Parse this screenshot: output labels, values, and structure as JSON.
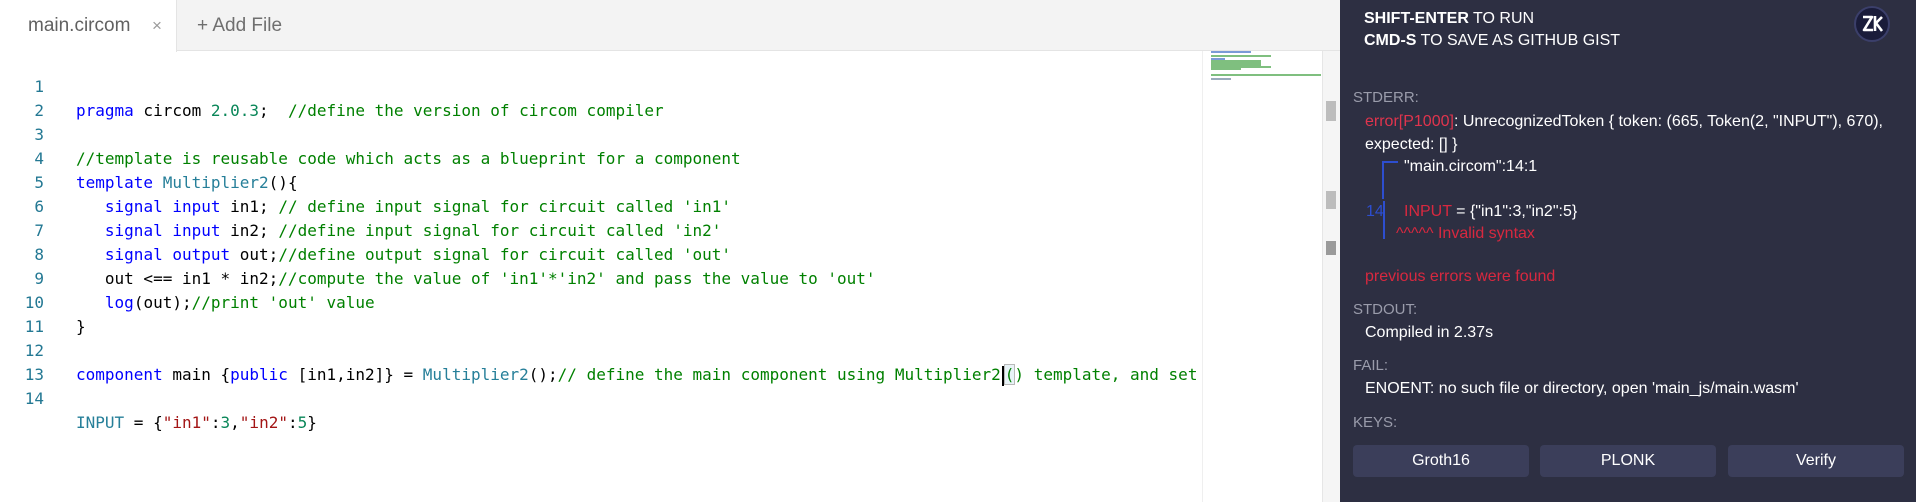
{
  "tabs": {
    "active": "main.circom",
    "close_glyph": "×",
    "add_file": "+ Add File"
  },
  "editor": {
    "line_numbers": [
      "1",
      "2",
      "3",
      "4",
      "5",
      "6",
      "7",
      "8",
      "9",
      "10",
      "11",
      "12",
      "13",
      "14"
    ],
    "lines": [
      "pragma circom 2.0.3;  //define the version of circom compiler",
      "",
      "//template is reusable code which acts as a blueprint for a component",
      "template Multiplier2(){",
      "   signal input in1; // define input signal for circuit called 'in1'",
      "   signal input in2; //define input signal for circuit called 'in2'",
      "   signal output out;//define output signal for circuit called 'out'",
      "   out <== in1 * in2;//compute the value of 'in1'*'in2' and pass the value to 'out'",
      "   log(out);//print 'out' value",
      "}",
      "",
      "component main {public [in1,in2]} = Multiplier2();// define the main component using Multiplier2() template, and set",
      "",
      "INPUT = {\"in1\":3,\"in2\":5}"
    ]
  },
  "output": {
    "hint_line1_bold": "SHIFT-ENTER",
    "hint_line1_rest": " TO RUN",
    "hint_line2_bold": "CMD-S",
    "hint_line2_rest": " TO SAVE AS GITHUB GIST",
    "logo_icon": "zk-logo-icon",
    "stderr_label": "STDERR:",
    "error_code": "error[P1000]",
    "error_msg_1": ": UnrecognizedToken { token: (665, Token(2, \"INPUT\"), 670),",
    "error_msg_2": "expected: [] }",
    "error_location": "\"main.circom\":14:1",
    "error_line_number": "14",
    "error_source_prefix": "INPUT",
    "error_source_rest": " = {\"in1\":3,\"in2\":5}",
    "error_caret": "^^^^^ Invalid syntax",
    "previous_errors": "previous errors were found",
    "stdout_label": "STDOUT:",
    "stdout_text": "Compiled in 2.37s",
    "fail_label": "FAIL:",
    "fail_text": "ENOENT: no such file or directory, open 'main_js/main.wasm'",
    "keys_label": "KEYS:",
    "buttons": [
      "Groth16",
      "PLONK",
      "Verify"
    ],
    "colors": {
      "panel_bg": "#2d2f42",
      "error": "#e0344d",
      "button_bg": "#3b3e5a"
    }
  }
}
